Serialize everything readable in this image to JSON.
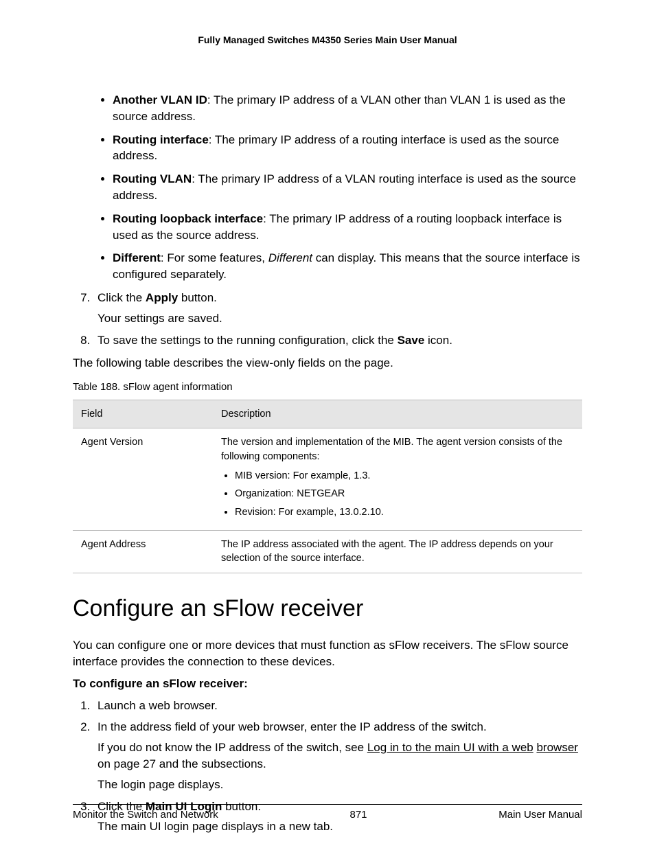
{
  "header": {
    "title": "Fully Managed Switches M4350 Series Main User Manual"
  },
  "bullets": [
    {
      "term": "Another VLAN ID",
      "desc": ": The primary IP address of a VLAN other than VLAN 1 is used as the source address."
    },
    {
      "term": "Routing interface",
      "desc": ": The primary IP address of a routing interface is used as the source address."
    },
    {
      "term": "Routing VLAN",
      "desc": ": The primary IP address of a VLAN routing interface is used as the source address."
    },
    {
      "term": "Routing loopback interface",
      "desc": ": The primary IP address of a routing loopback interface is used as the source address."
    }
  ],
  "different_bullet": {
    "term": "Different",
    "pre": ": For some features, ",
    "italic": "Different",
    "post": " can display. This means that the source interface is configured separately."
  },
  "step7": {
    "pre": "Click the ",
    "bold": "Apply",
    "post": " button.",
    "sub": "Your settings are saved."
  },
  "step8": {
    "pre": "To save the settings to the running configuration, click the ",
    "bold": "Save",
    "post": " icon."
  },
  "table_intro": "The following table describes the view-only fields on the page.",
  "table_caption": "Table 188. sFlow agent information",
  "table": {
    "headers": [
      "Field",
      "Description"
    ],
    "rows": [
      {
        "field": "Agent Version",
        "desc": "The version and implementation of the MIB. The agent version consists of the following components:",
        "items": [
          "MIB version: For example, 1.3.",
          "Organization: NETGEAR",
          "Revision: For example, 13.0.2.10."
        ]
      },
      {
        "field": "Agent Address",
        "desc": "The IP address associated with the agent. The IP address depends on your selection of the source interface."
      }
    ]
  },
  "section": {
    "title": "Configure an sFlow receiver",
    "intro": "You can configure one or more devices that must function as sFlow receivers. The sFlow source interface provides the connection to these devices.",
    "procedure_heading": "To configure an sFlow receiver:",
    "steps": {
      "s1": "Launch a web browser.",
      "s2": {
        "text": "In the address field of your web browser, enter the IP address of the switch.",
        "sub_pre": "If you do not know the IP address of the switch, see ",
        "link1": "Log in to the main UI with a web",
        "link2": "browser",
        "sub_post": " on page 27 and the subsections.",
        "sub2": "The login page displays."
      },
      "s3": {
        "pre": "Click the ",
        "bold": "Main UI Login",
        "post": " button.",
        "sub": "The main UI login page displays in a new tab."
      }
    }
  },
  "footer": {
    "left": "Monitor the Switch and Network",
    "center": "871",
    "right": "Main User Manual"
  }
}
